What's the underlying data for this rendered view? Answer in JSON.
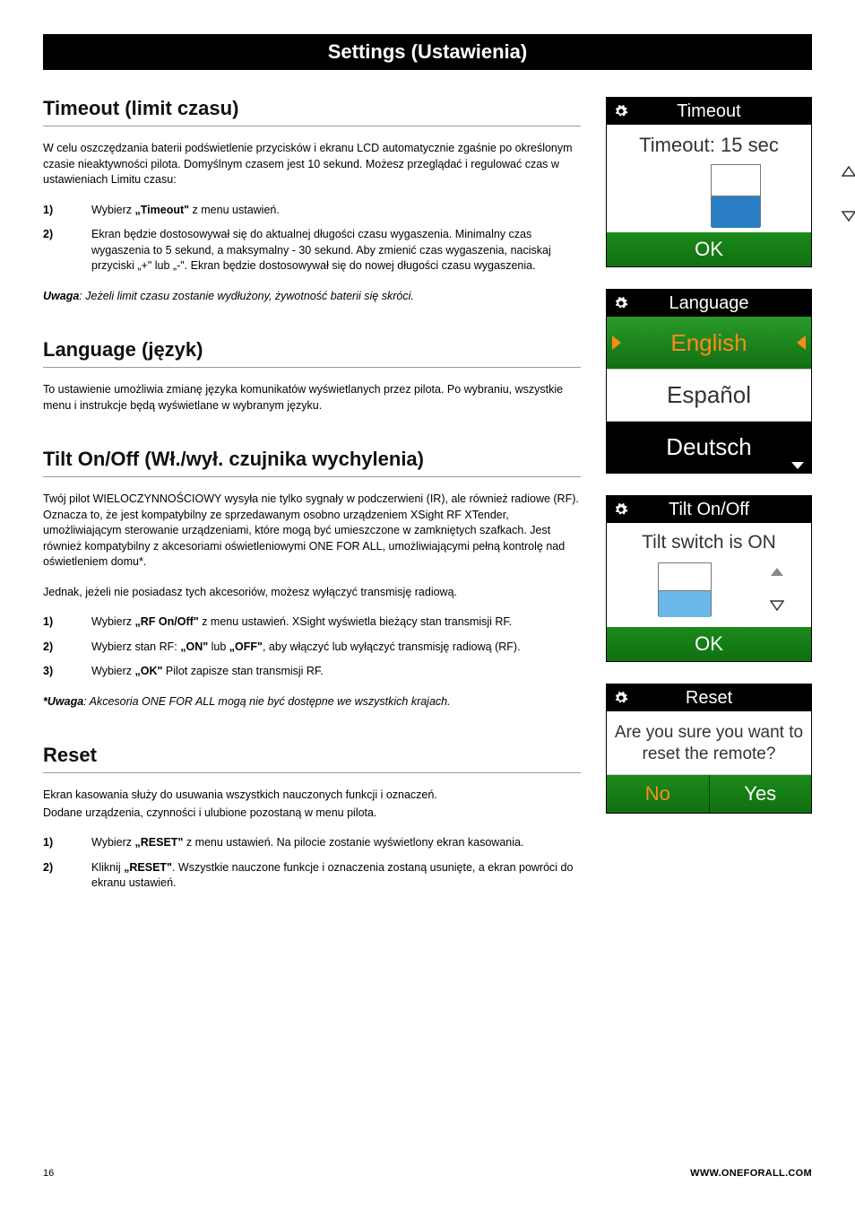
{
  "header": {
    "title": "Settings (Ustawienia)"
  },
  "timeout": {
    "heading": "Timeout (limit czasu)",
    "intro": "W celu oszczędzania baterii podświetlenie przycisków i ekranu LCD automatycznie zgaśnie po określonym czasie nieaktywności pilota. Domyślnym czasem jest 10 sekund. Możesz przeglądać i regulować czas w ustawieniach Limitu czasu:",
    "steps": [
      {
        "n": "1)",
        "text_pre": "Wybierz ",
        "bold": "„Timeout\"",
        "text_post": " z menu ustawień."
      },
      {
        "n": "2)",
        "text_pre": "Ekran będzie dostosowywał się do aktualnej długości czasu wygaszenia. Minimalny czas wygaszenia to 5 sekund, a maksymalny - 30 sekund. Aby zmienić czas wygaszenia, naciskaj przyciski „+\" lub „-\". Ekran będzie dostosowywał się do nowej długości czasu wygaszenia.",
        "bold": "",
        "text_post": ""
      }
    ],
    "note_bold": "Uwaga",
    "note_rest": ": Jeżeli limit czasu zostanie wydłużony, żywotność baterii się skróci."
  },
  "language": {
    "heading": "Language (język)",
    "intro": "To ustawienie umożliwia zmianę języka komunikatów wyświetlanych przez pilota. Po wybraniu, wszystkie menu i instrukcje będą wyświetlane w wybranym języku."
  },
  "tilt": {
    "heading": "Tilt On/Off (Wł./wył. czujnika wychylenia)",
    "p1": "Twój pilot WIELOCZYNNOŚCIOWY wysyła nie tylko sygnały w podczerwieni (IR), ale również radiowe (RF). Oznacza to, że jest kompatybilny ze sprzedawanym osobno urządzeniem XSight RF XTender, umożliwiającym sterowanie urządzeniami, które mogą być umieszczone w zamkniętych szafkach. Jest również kompatybilny z akcesoriami oświetleniowymi ONE FOR ALL, umożliwiającymi pełną kontrolę nad oświetleniem domu*.",
    "p2": "Jednak, jeżeli nie posiadasz tych akcesoriów, możesz wyłączyć transmisję radiową.",
    "steps": [
      {
        "n": "1)",
        "pre": "Wybierz ",
        "b1": "„RF On/Off\"",
        "post": " z menu ustawień. XSight wyświetla bieżący stan transmisji RF."
      },
      {
        "n": "2)",
        "pre": "Wybierz stan RF: ",
        "b1": "„ON\"",
        "mid": " lub ",
        "b2": "„OFF\"",
        "post": ", aby włączyć lub wyłączyć transmisję radiową (RF)."
      },
      {
        "n": "3)",
        "pre": "Wybierz ",
        "b1": "„OK\"",
        "post": " Pilot zapisze stan transmisji RF."
      }
    ],
    "note_bold": "*Uwaga",
    "note_rest": ": Akcesoria ONE FOR ALL mogą nie być dostępne we wszystkich krajach."
  },
  "reset": {
    "heading": "Reset",
    "p1": "Ekran kasowania służy do usuwania wszystkich nauczonych funkcji i oznaczeń.",
    "p2": "Dodane urządzenia, czynności i ulubione pozostaną w menu pilota.",
    "steps": [
      {
        "n": "1)",
        "pre": "Wybierz ",
        "b1": "„RESET\"",
        "post": " z menu ustawień. Na pilocie zostanie wyświetlony ekran kasowania."
      },
      {
        "n": "2)",
        "pre": "Kliknij ",
        "b1": "„RESET\"",
        "post": ". Wszystkie nauczone funkcje i oznaczenia zostaną usunięte, a ekran powróci do ekranu ustawień."
      }
    ]
  },
  "screens": {
    "timeout": {
      "title": "Timeout",
      "body": "Timeout: 15 sec",
      "ok": "OK",
      "fill_color": "#2a7fc4"
    },
    "language": {
      "title": "Language",
      "options": [
        "English",
        "Español",
        "Deutsch"
      ],
      "selected_index": 0
    },
    "tilt": {
      "title": "Tilt On/Off",
      "body": "Tilt switch is ON",
      "ok": "OK"
    },
    "reset": {
      "title": "Reset",
      "body": "Are you sure you want to reset the remote?",
      "no": "No",
      "yes": "Yes"
    }
  },
  "footer": {
    "page": "16",
    "url": "WWW.ONEFORALL.COM"
  }
}
